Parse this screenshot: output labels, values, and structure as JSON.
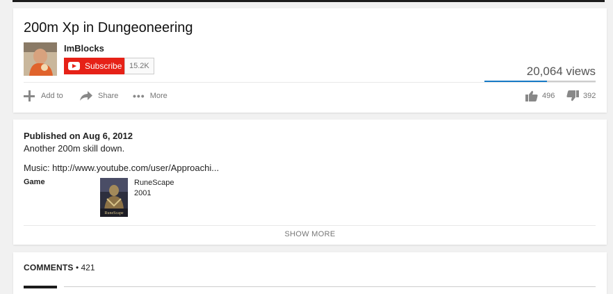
{
  "video": {
    "title": "200m Xp in Dungeoneering",
    "channel": "ImBlocks",
    "subscribe_label": "Subscribe",
    "subscriber_count": "15.2K",
    "views": "20,064 views",
    "like_ratio": 0.56
  },
  "actions": {
    "add_to": "Add to",
    "share": "Share",
    "more": "More",
    "likes": "496",
    "dislikes": "392"
  },
  "description": {
    "published": "Published on Aug 6, 2012",
    "line1": "Another 200m skill down.",
    "music": "Music: http://www.youtube.com/user/Approachi...",
    "game_label": "Game",
    "game_name": "RuneScape",
    "game_year": "2001",
    "game_logo_text": "RuneScape",
    "show_more": "SHOW MORE"
  },
  "comments": {
    "label": "COMMENTS",
    "count": "421"
  },
  "colors": {
    "accent": "#167ac6",
    "subscribe": "#e62117"
  }
}
